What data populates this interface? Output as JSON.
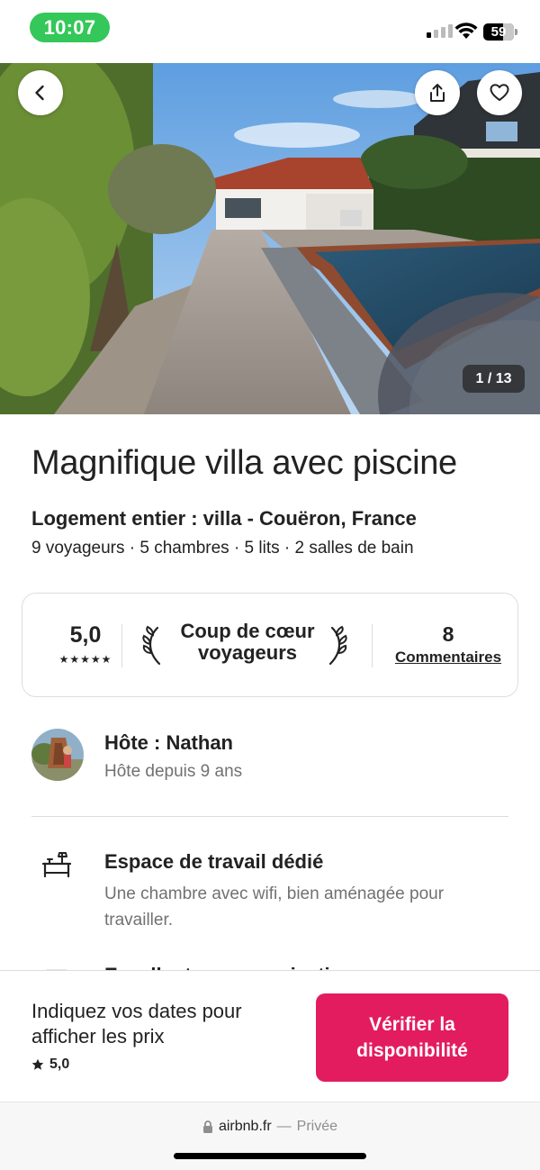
{
  "status_bar": {
    "time": "10:07",
    "battery": "59",
    "icons": [
      "signal-icon",
      "wifi-icon",
      "battery-icon"
    ]
  },
  "hero": {
    "photo_counter": "1 / 13",
    "buttons": [
      "back-arrow-icon",
      "share-icon",
      "heart-icon"
    ]
  },
  "listing": {
    "title": "Magnifique villa avec piscine",
    "subtitle": "Logement entier : villa - Couëron, France",
    "details": "9 voyageurs · 5 chambres · 5 lits · 2 salles de bain"
  },
  "rating_card": {
    "score": "5,0",
    "stars": "★★★★★",
    "favorite_label": "Coup de cœur voyageurs",
    "review_count": "8",
    "review_label": "Commentaires"
  },
  "host": {
    "name": "Hôte : Nathan",
    "since": "Hôte depuis 9 ans"
  },
  "features": [
    {
      "icon": "desk-icon",
      "title": "Espace de travail dédié",
      "description": "Une chambre avec wifi, bien aménagée pour travailler."
    },
    {
      "icon": "checkin-icon",
      "title": "Excellente communication"
    }
  ],
  "footer": {
    "prompt": "Indiquez vos dates pour afficher les prix",
    "rating": "5,0",
    "button_label": "Vérifier la disponibilité"
  },
  "browser": {
    "domain": "airbnb.fr",
    "separator": "—",
    "mode": "Privée"
  },
  "colors": {
    "brand": "#e31c5f",
    "status_pill": "#34c759",
    "text": "#222222",
    "muted": "#717171",
    "border": "#dddddd"
  }
}
